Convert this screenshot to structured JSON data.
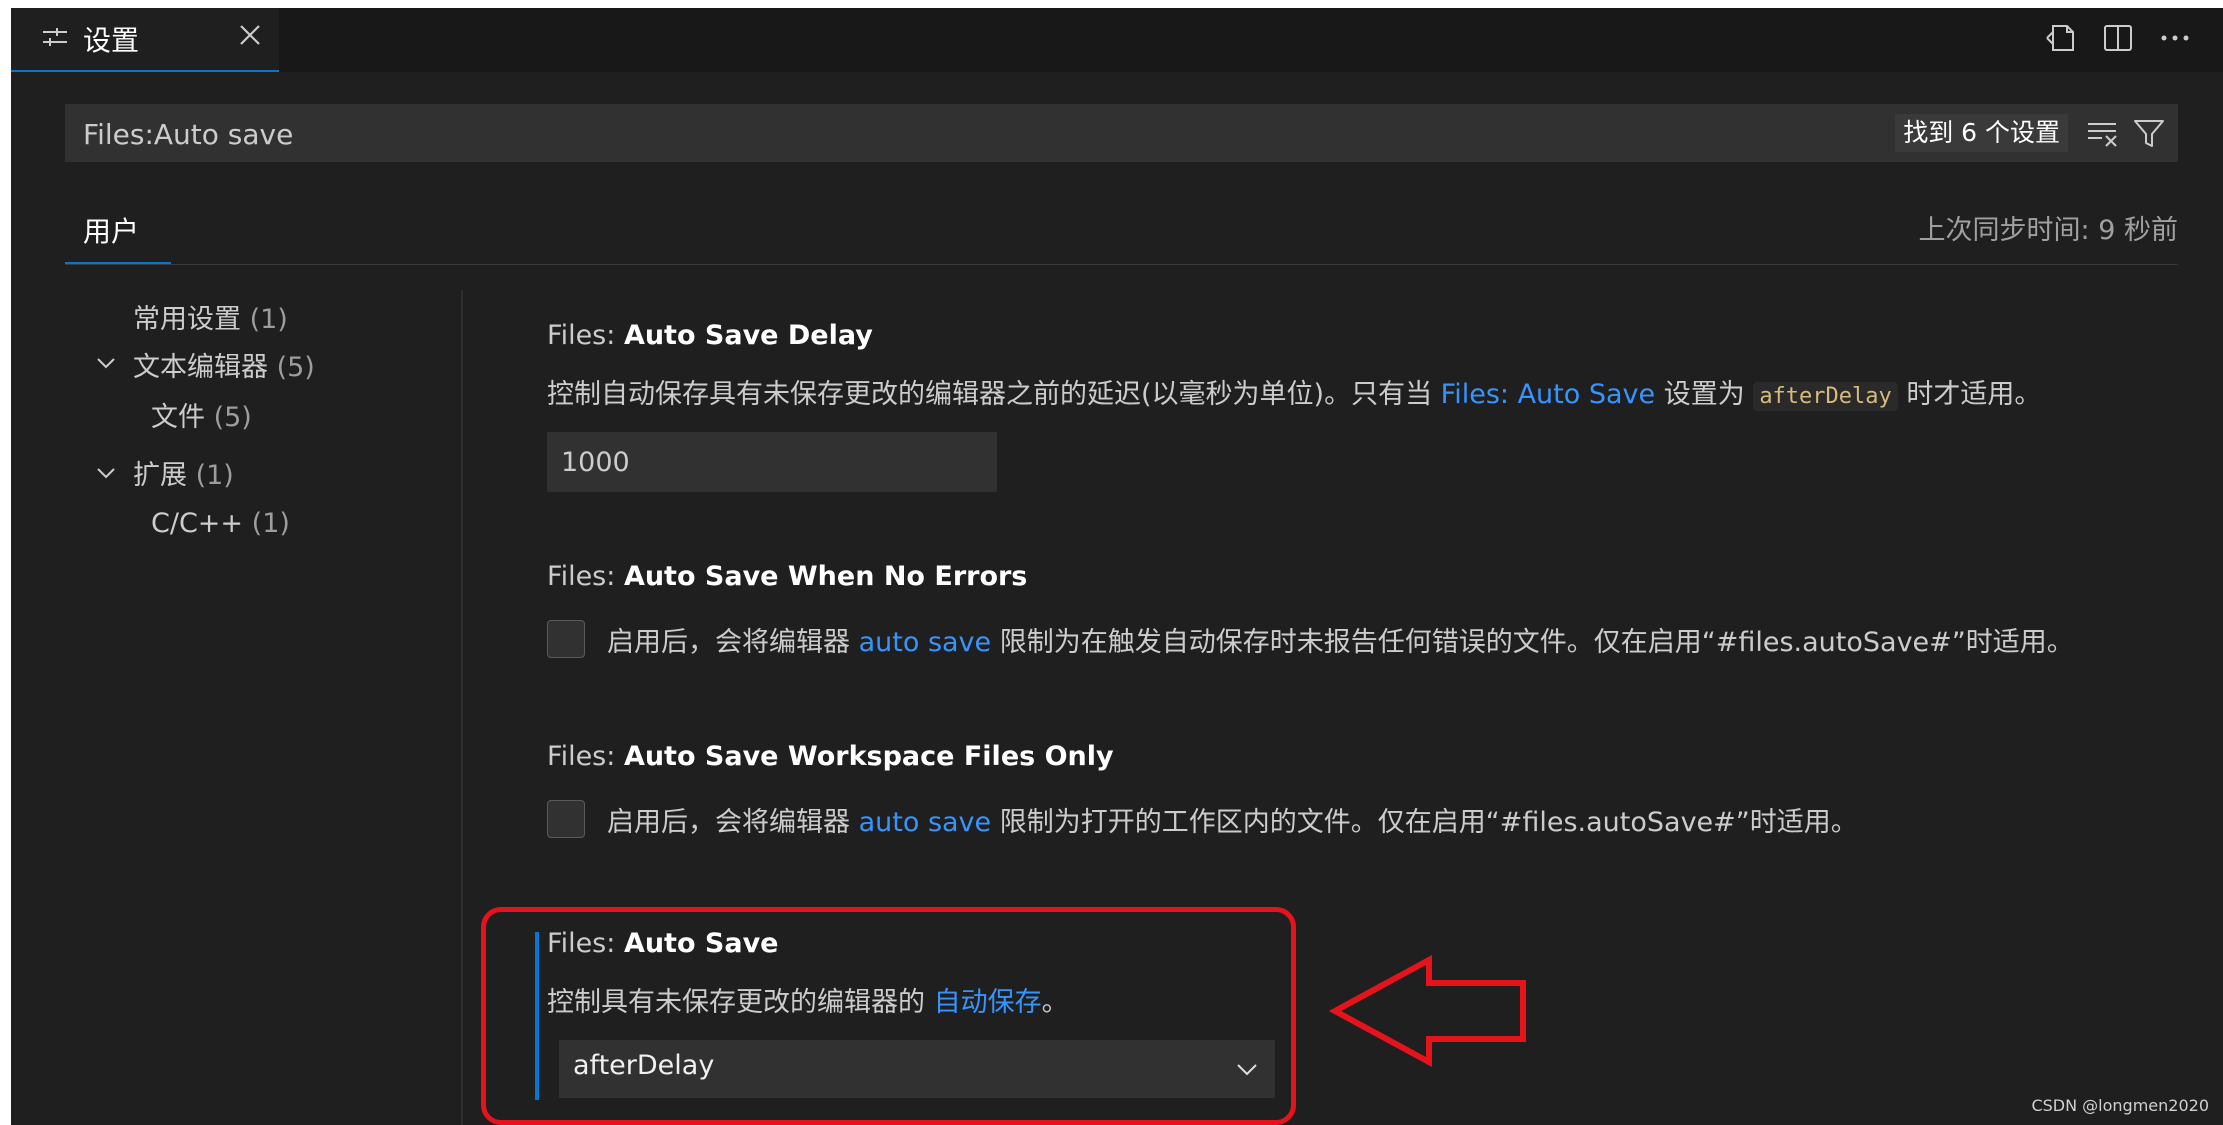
{
  "tab": {
    "title": "设置"
  },
  "search": {
    "value": "Files:Auto save",
    "result_count": "找到 6 个设置"
  },
  "scope": {
    "user_tab": "用户",
    "sync_status": "上次同步时间: 9 秒前"
  },
  "toc": [
    {
      "label": "常用设置",
      "count": "(1)"
    },
    {
      "label": "文本编辑器",
      "count": "(5)"
    },
    {
      "label": "文件",
      "count": "(5)"
    },
    {
      "label": "扩展",
      "count": "(1)"
    },
    {
      "label": "C/C++",
      "count": "(1)"
    }
  ],
  "settings": {
    "auto_save_delay": {
      "category": "Files: ",
      "name": "Auto Save Delay",
      "desc_before": "控制自动保存具有未保存更改的编辑器之前的延迟(以毫秒为单位)。只有当 ",
      "desc_link": "Files: Auto Save",
      "desc_mid": " 设置为 ",
      "desc_code": "afterDelay",
      "desc_after": " 时才适用。",
      "value": "1000"
    },
    "auto_save_no_errors": {
      "category": "Files: ",
      "name": "Auto Save When No Errors",
      "desc_before": "启用后，会将编辑器 ",
      "desc_link": "auto save",
      "desc_after": " 限制为在触发自动保存时未报告任何错误的文件。仅在启用“#files.autoSave#”时适用。",
      "checked": false
    },
    "auto_save_workspace": {
      "category": "Files: ",
      "name": "Auto Save Workspace Files Only",
      "desc_before": "启用后，会将编辑器 ",
      "desc_link": "auto save",
      "desc_after": " 限制为打开的工作区内的文件。仅在启用“#files.autoSave#”时适用。",
      "checked": false
    },
    "auto_save": {
      "category": "Files: ",
      "name": "Auto Save",
      "desc_before": "控制具有未保存更改的编辑器的 ",
      "desc_link": "自动保存",
      "desc_after": "。",
      "value": "afterDelay"
    }
  },
  "watermark": "CSDN @longmen2020",
  "colors": {
    "accent": "#0078d4",
    "link": "#3794ff",
    "annotation": "#e5141c",
    "background": "#1f1f1f"
  },
  "icons": [
    "settings-sliders-icon",
    "close-icon",
    "open-json-icon",
    "split-editor-icon",
    "more-actions-icon",
    "clear-filter-icon",
    "filter-icon",
    "chevron-down-icon"
  ]
}
